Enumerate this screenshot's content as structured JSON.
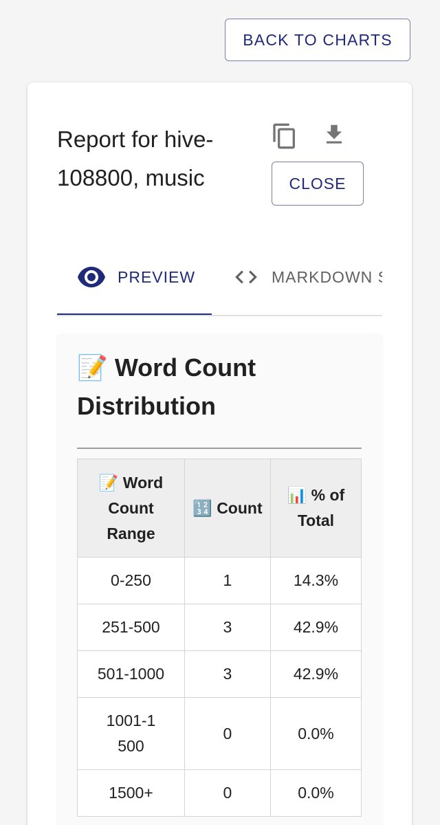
{
  "header": {
    "back_label": "BACK TO CHARTS"
  },
  "report": {
    "title": "Report for hive-108800, music",
    "close_label": "CLOSE",
    "copy_icon": "copy-icon",
    "download_icon": "download-icon"
  },
  "tabs": [
    {
      "label": "PREVIEW",
      "icon": "eye-icon",
      "active": true
    },
    {
      "label": "MARKDOWN SOURCE",
      "icon": "code-icon",
      "active": false
    }
  ],
  "section": {
    "heading": "📝 Word Count Distribution"
  },
  "table": {
    "headers": [
      "📝 Word Count Range",
      "🔢 Count",
      "📊 % of Total"
    ],
    "rows": [
      [
        "0-250",
        "1",
        "14.3%"
      ],
      [
        "251-500",
        "3",
        "42.9%"
      ],
      [
        "501-1000",
        "3",
        "42.9%"
      ],
      [
        "1001-1500",
        "0",
        "0.0%"
      ],
      [
        "1500+",
        "0",
        "0.0%"
      ]
    ]
  },
  "colors": {
    "accent": "#1f2a78",
    "border": "#7a81a8",
    "tab_inactive": "#616161"
  }
}
